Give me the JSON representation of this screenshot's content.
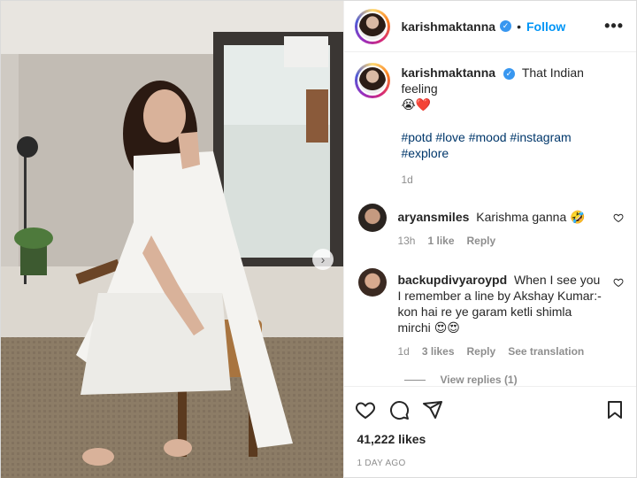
{
  "post": {
    "author": "karishmaktanna",
    "follow_label": "Follow",
    "more_label": "•••",
    "verified_mark": "✓",
    "caption_text": "That Indian feeling",
    "caption_emoji": "😭❤️",
    "hashtags": "#potd #love #mood #instagram #explore",
    "caption_time": "1d",
    "likes": "41,222 likes",
    "date": "1 DAY AGO",
    "carousel_next": "›"
  },
  "comments": [
    {
      "user": "aryansmiles",
      "text": "Karishma ganna",
      "emoji": "🤣",
      "time": "13h",
      "likes": "1 like",
      "reply": "Reply"
    },
    {
      "user": "backupdivyaroypd",
      "text": "When I see you I remember a line by Akshay Kumar:- kon hai re ye garam ketli shimla mirchi",
      "emoji": "😍😍",
      "time": "1d",
      "likes": "3 likes",
      "reply": "Reply",
      "translate": "See translation",
      "view_replies": "View replies (1)"
    }
  ],
  "colors": {
    "accent": "#0095f6",
    "verified": "#3897f0",
    "heart": "#ed4956",
    "muted": "#8e8e8e"
  },
  "icons": [
    "heart-icon",
    "comment-icon",
    "share-icon",
    "bookmark-icon",
    "verified-icon",
    "more-icon",
    "chevron-right-icon"
  ]
}
